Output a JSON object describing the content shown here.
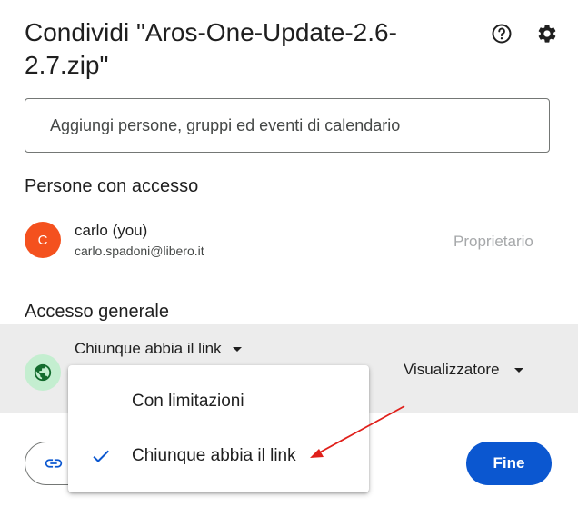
{
  "dialog": {
    "title": "Condividi \"Aros-One-Update-2.6-2.7.zip\"",
    "help_icon": "help-circle-icon",
    "settings_icon": "gear-icon"
  },
  "search": {
    "placeholder": "Aggiungi persone, gruppi ed eventi di calendario",
    "value": ""
  },
  "people": {
    "section_title": "Persone con accesso",
    "items": [
      {
        "avatar_letter": "C",
        "avatar_color": "#f4511e",
        "name": "carlo (you)",
        "email": "carlo.spadoni@libero.it",
        "role": "Proprietario"
      }
    ]
  },
  "general_access": {
    "section_title": "Accesso generale",
    "selected": "Chiunque abbia il link",
    "icon": "globe-icon",
    "role": "Visualizzatore"
  },
  "dropdown_menu": {
    "items": [
      {
        "label": "Con limitazioni",
        "checked": false
      },
      {
        "label": "Chiunque abbia il link",
        "checked": true
      }
    ]
  },
  "footer": {
    "copy_link_icon": "link-icon",
    "done_label": "Fine"
  },
  "colors": {
    "primary": "#0b57d0",
    "annotation_arrow": "#e0201b"
  }
}
